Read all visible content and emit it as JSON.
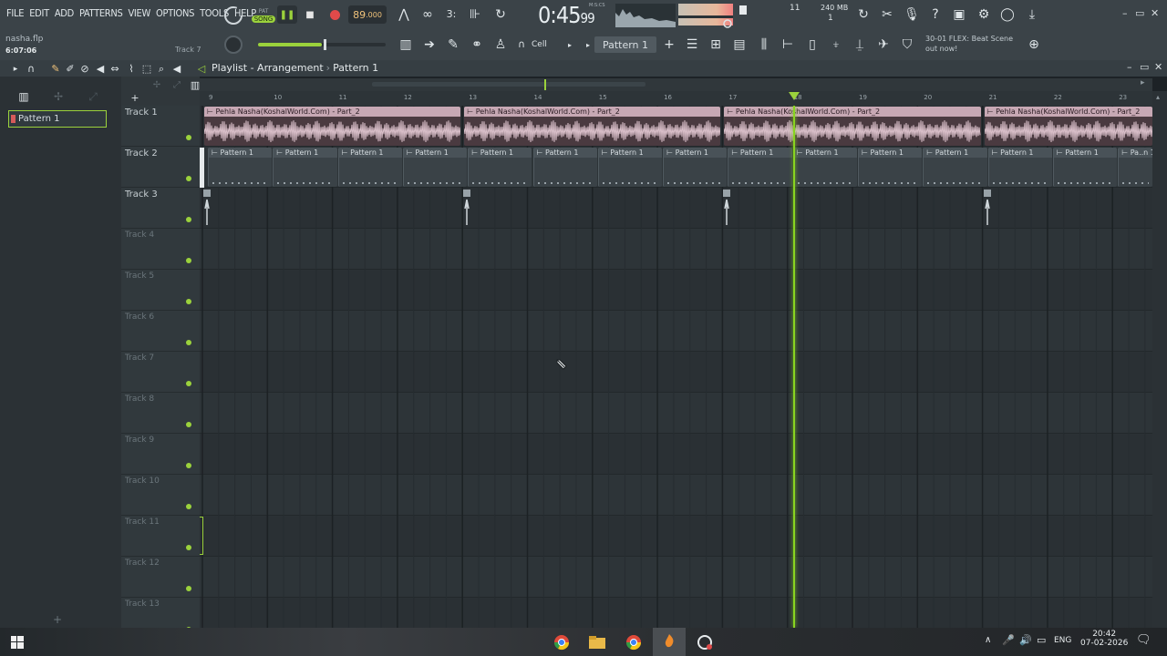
{
  "menu": [
    "FILE",
    "EDIT",
    "ADD",
    "PATTERNS",
    "VIEW",
    "OPTIONS",
    "TOOLS",
    "HELP"
  ],
  "project": {
    "file": "nasha.flp",
    "length": "6:07:06",
    "hint": "Track 7"
  },
  "transport": {
    "pat": "PAT",
    "song": "SONG",
    "tempo": "89",
    "tempo_dec": ".000",
    "time_main": "0:45",
    "time_sub": "99",
    "time_label": "M:S:CS"
  },
  "monitor": {
    "voices": "11",
    "memory": "240 MB",
    "memory_sub": "1"
  },
  "toolbar": {
    "snap": "Cell",
    "pattern": "Pattern 1"
  },
  "news": {
    "line1": "30-01  FLEX: Beat Scene",
    "line2": "out now!"
  },
  "playlist": {
    "title": "Playlist - Arrangement",
    "pattern": "Pattern 1"
  },
  "browser": {
    "item": "Pattern 1"
  },
  "ruler": [
    "9",
    "10",
    "11",
    "12",
    "13",
    "14",
    "15",
    "16",
    "17",
    "18",
    "19",
    "20",
    "21",
    "22",
    "23"
  ],
  "tracks": [
    "Track 1",
    "Track 2",
    "Track 3",
    "Track 4",
    "Track 5",
    "Track 6",
    "Track 7",
    "Track 8",
    "Track 9",
    "Track 10",
    "Track 11",
    "Track 12",
    "Track 13"
  ],
  "audio_clip": "Pehla Nasha(KoshalWorld.Com) - Part_2",
  "pattern_clip": "Pattern 1",
  "pattern_clip_short": "Pa..n 1",
  "taskbar": {
    "lang": "ENG",
    "time": "20:42",
    "date": "07-02-2026"
  },
  "colors": {
    "accent": "#9bd23c",
    "clip_audio": "#c7a8b4",
    "record": "#e04a4a",
    "tempo": "#f0c27a"
  }
}
